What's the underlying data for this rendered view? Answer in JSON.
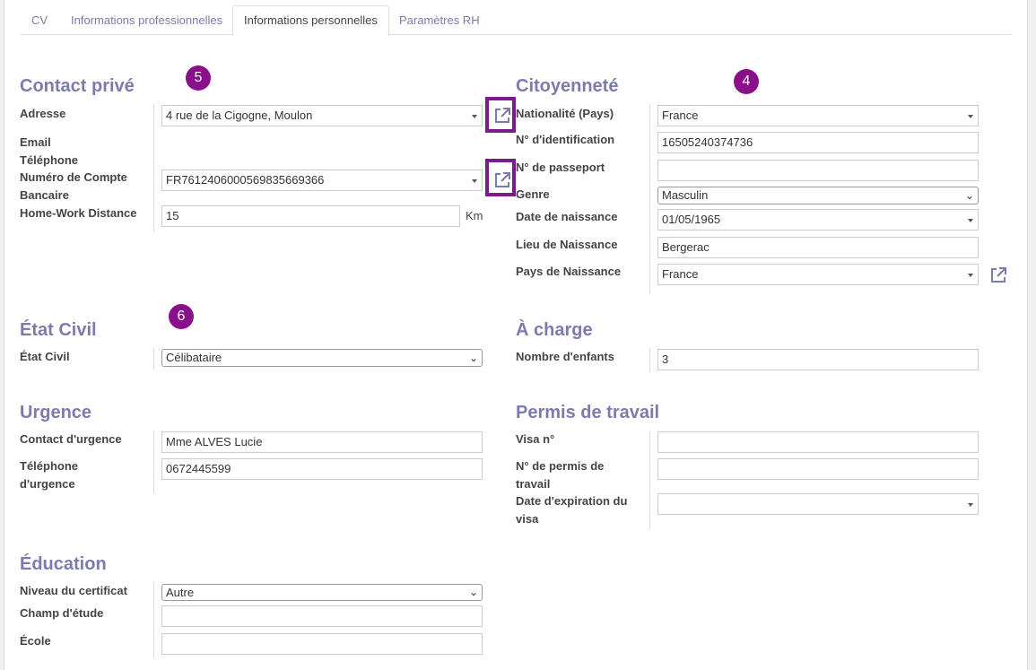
{
  "tabs": [
    "CV",
    "Informations professionnelles",
    "Informations personnelles",
    "Paramètres RH"
  ],
  "active_tab": "Informations personnelles",
  "badges": {
    "contact": "5",
    "citizenship": "4",
    "civil": "6"
  },
  "contact_prive": {
    "title": "Contact privé",
    "labels": {
      "address": "Adresse",
      "email": "Email",
      "phone": "Téléphone",
      "bank_1": "Numéro de Compte",
      "bank_2": "Bancaire",
      "distance": "Home-Work Distance"
    },
    "values": {
      "address": "4 rue de la Cigogne, Moulon",
      "bank": "FR7612406000569835669366",
      "distance": "15"
    },
    "distance_unit": "Km"
  },
  "citoyennete": {
    "title": "Citoyenneté",
    "labels": {
      "nationality": "Nationalité (Pays)",
      "id": "N° d'identification",
      "passport": "N° de passeport",
      "gender": "Genre",
      "birthdate": "Date de naissance",
      "birthplace": "Lieu de Naissance",
      "birth_country": "Pays de Naissance"
    },
    "values": {
      "nationality": "France",
      "id": "16505240374736",
      "passport": "",
      "gender": "Masculin",
      "birthdate": "01/05/1965",
      "birthplace": "Bergerac",
      "birth_country": "France"
    }
  },
  "etat_civil": {
    "title": "État Civil",
    "label": "État Civil",
    "value": "Célibataire"
  },
  "a_charge": {
    "title": "À charge",
    "label": "Nombre d'enfants",
    "value": "3"
  },
  "urgence": {
    "title": "Urgence",
    "labels": {
      "contact": "Contact d'urgence",
      "phone_1": "Téléphone",
      "phone_2": "d'urgence"
    },
    "values": {
      "contact": "Mme ALVES Lucie",
      "phone": "0672445599"
    }
  },
  "permis": {
    "title": "Permis de travail",
    "labels": {
      "visa": "Visa n°",
      "permit_1": "N° de permis de",
      "permit_2": "travail",
      "expiry_1": "Date d'expiration du",
      "expiry_2": "visa"
    },
    "values": {
      "visa": "",
      "permit": "",
      "expiry": ""
    }
  },
  "education": {
    "title": "Éducation",
    "labels": {
      "level": "Niveau du certificat",
      "field": "Champ d'étude",
      "school": "École"
    },
    "values": {
      "level": "Autre",
      "field": "",
      "school": ""
    }
  },
  "colors": {
    "accent": "#7c7bad",
    "highlight": "#7b1a8b",
    "badge": "#8a0f8a"
  }
}
